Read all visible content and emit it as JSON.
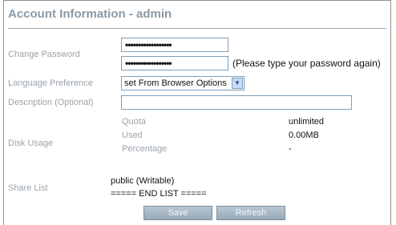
{
  "title": "Account Information - admin",
  "password": {
    "label": "Change Password",
    "value1": "••••••••••••••••••",
    "value2": "••••••••••••••••••",
    "hint": "(Please type your password again)"
  },
  "language": {
    "label": "Language Preference",
    "selected": "set From Browser Options"
  },
  "description": {
    "label": "Description (Optional)",
    "value": ""
  },
  "disk": {
    "label": "Disk Usage",
    "rows": [
      {
        "name": "Quota",
        "value": "unlimited"
      },
      {
        "name": "Used",
        "value": "0.00MB"
      },
      {
        "name": "Percentage",
        "value": "-"
      }
    ]
  },
  "share": {
    "label": "Share List",
    "item": "public (Writable)",
    "end": "===== END LIST ====="
  },
  "buttons": {
    "save": "Save",
    "refresh": "Refresh"
  }
}
